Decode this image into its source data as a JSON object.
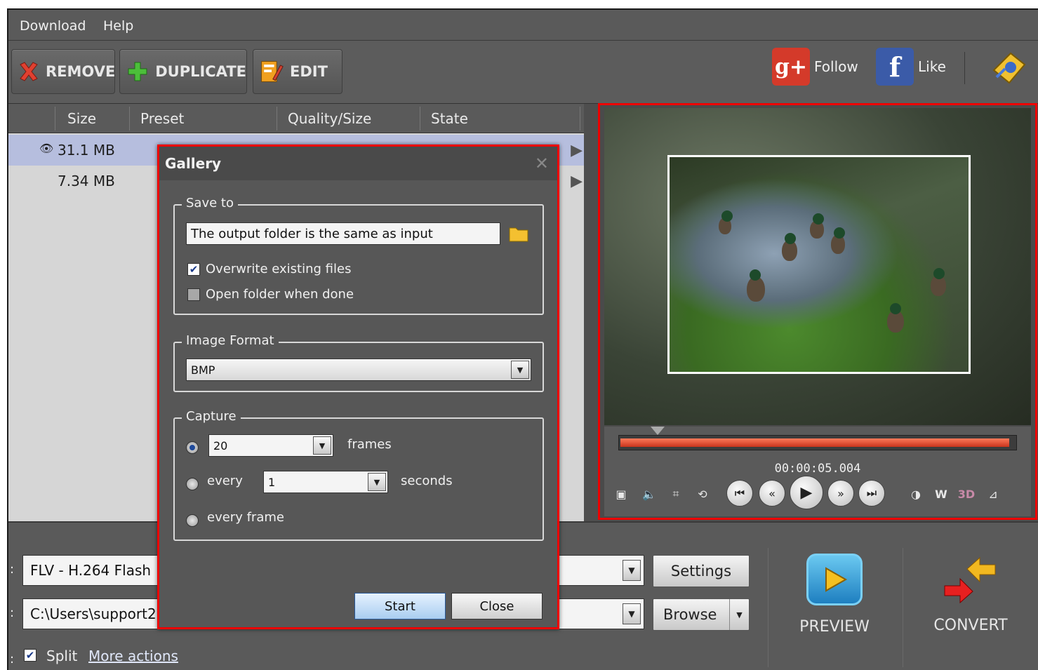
{
  "menu": {
    "items": [
      "Download",
      "Help"
    ]
  },
  "toolbar": {
    "remove_label": "REMOVE",
    "duplicate_label": "DUPLICATE",
    "edit_label": "EDIT",
    "follow_label": "Follow",
    "like_label": "Like"
  },
  "filelist": {
    "columns": [
      "Size",
      "Preset",
      "Quality/Size",
      "State"
    ],
    "rows": [
      {
        "size": "31.1 MB",
        "selected": true
      },
      {
        "size": "7.34 MB",
        "selected": false
      }
    ]
  },
  "bottom": {
    "format_value": "FLV - H.264 Flash",
    "path_value": "C:\\Users\\support2",
    "settings_label": "Settings",
    "browse_label": "Browse",
    "split_label": "Split",
    "more_actions_label": "More actions",
    "preview_label": "PREVIEW",
    "convert_label": "CONVERT",
    "colon": ":"
  },
  "preview": {
    "timecode": "00:00:05.004",
    "seek_progress": 0.985
  },
  "dialog": {
    "title": "Gallery",
    "save_to": {
      "label": "Save to",
      "path_value": "The output folder is the same as input",
      "overwrite_label": "Overwrite existing files",
      "overwrite_checked": true,
      "open_folder_label": "Open folder when done",
      "open_folder_checked": false
    },
    "image_format": {
      "label": "Image Format",
      "value": "BMP"
    },
    "capture": {
      "label": "Capture",
      "frames_value": "20",
      "frames_unit": "frames",
      "every_label": "every",
      "every_value": "1",
      "every_unit": "seconds",
      "every_frame_label": "every frame",
      "selected": "frames"
    },
    "start_label": "Start",
    "close_label": "Close"
  },
  "colors": {
    "accent_red": "#e00000",
    "seek_fill": "#d8442a",
    "selected_row": "#b6bede"
  }
}
